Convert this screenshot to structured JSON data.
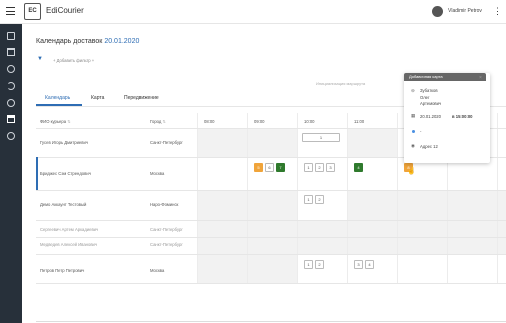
{
  "app": {
    "logo_text": "EC",
    "name": "EdiCourier",
    "user": "Vladimir Petrov"
  },
  "page": {
    "title": "Календарь доставок",
    "date": "20.01.2020",
    "add_filter": "+ Добавить фильтр +"
  },
  "tabs": [
    "Календарь",
    "Карта",
    "Передвижение"
  ],
  "table": {
    "col_name": "ФИО курьера",
    "col_city": "Город",
    "times": [
      "08:00",
      "09:00",
      "10:00",
      "11:00"
    ],
    "rows": [
      {
        "name": "Гусев Игорь Дмитриевич",
        "city": "Санкт-Петербург",
        "muted": false
      },
      {
        "name": "Бриджес Сэм Стрендович",
        "city": "Москва",
        "muted": false
      },
      {
        "name": "Демо Аккаунт Тестовый",
        "city": "Наро-Фоминск",
        "muted": false
      },
      {
        "name": "Сергеевич Артем Аркадиевич",
        "city": "Санкт-Петербург",
        "muted": true
      },
      {
        "name": "Медведев Алексей Иванович",
        "city": "Санкт-Петербург",
        "muted": true
      },
      {
        "name": "Петров Петр Петрович",
        "city": "Москва",
        "muted": false
      }
    ]
  },
  "slots": {
    "r1_1000": "1",
    "r2_0900": [
      "5",
      "6",
      "7"
    ],
    "r2_1000": [
      "1",
      "2",
      "3"
    ],
    "r2_1100": "4",
    "r2_1200": "8",
    "r3_1000": [
      "1",
      "2"
    ],
    "r6_1000": [
      "1",
      "2"
    ],
    "r6_1100": [
      "3",
      "4"
    ]
  },
  "combo_placeholder": "Инициализация маршрута",
  "popup": {
    "title": "Добавочная карта",
    "name_line1": "Зубатков",
    "name_line2": "Олег",
    "name_line3": "Артемович",
    "date": "20.01.2020",
    "time": "в 15:00:00",
    "dash": "-",
    "address": "Адрес 12"
  },
  "colors": {
    "accent": "#2e6db4",
    "sidebar": "#27303a",
    "orange": "#f0a43a",
    "green": "#2f7a2d"
  }
}
